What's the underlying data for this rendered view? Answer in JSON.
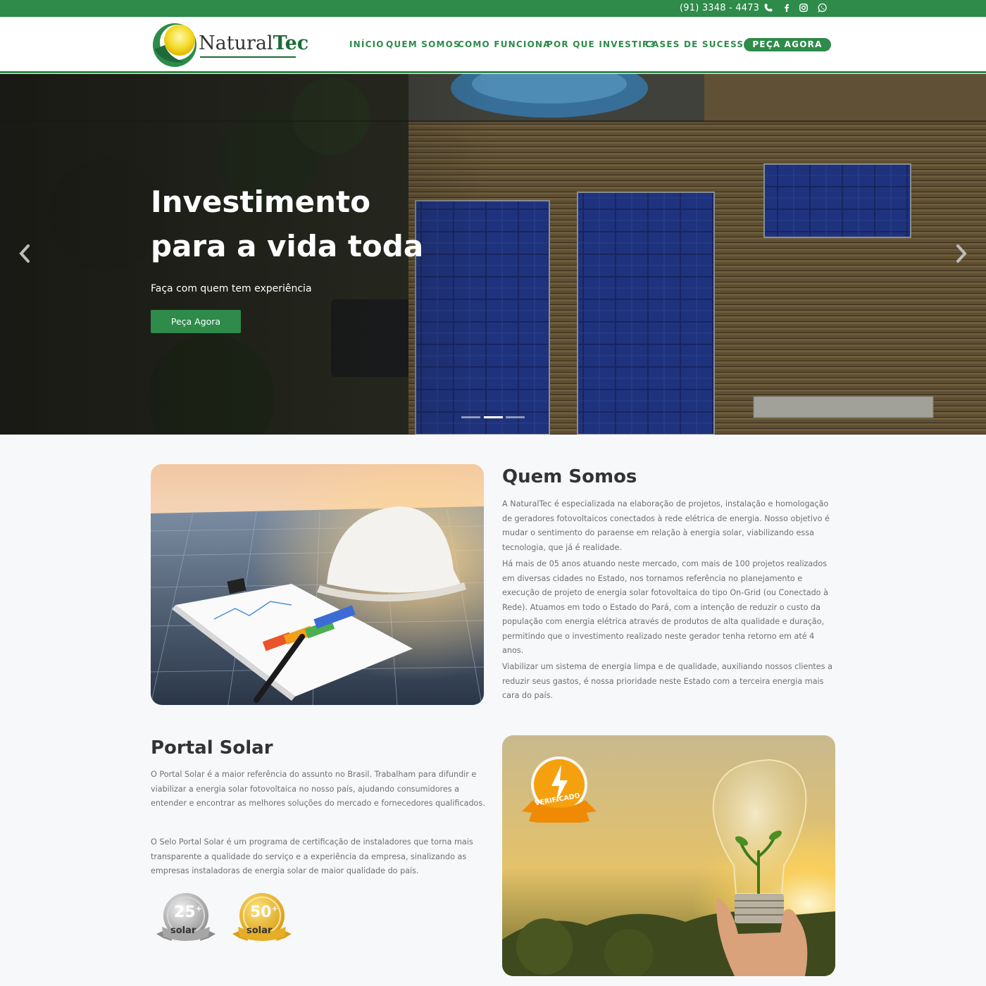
{
  "topbar": {
    "phone": "(91) 3348 - 4473",
    "icons": [
      "phone-icon",
      "facebook-icon",
      "instagram-icon",
      "whatsapp-icon"
    ],
    "color": "#2e8b4a"
  },
  "header": {
    "logo": {
      "part1": "Natural",
      "part2": "Tec"
    },
    "nav": [
      "INÍCIO",
      "QUEM SOMOS",
      "COMO FUNCIONA",
      "POR QUE INVESTIR?",
      "CASES DE SUCESSO"
    ],
    "cta": "PEÇA AGORA"
  },
  "hero": {
    "title_line1": "Investimento",
    "title_line2": "para a vida toda",
    "subtitle": "Faça com quem tem experiência",
    "button": "Peça Agora",
    "slide_count": 3,
    "active_slide": 2
  },
  "about": {
    "title": "Quem Somos",
    "paragraphs": [
      "A NaturalTec é especializada na elaboração de projetos, instalação e homologação de geradores fotovoltaicos conectados à rede elétrica de energia. Nosso objetivo é mudar o sentimento do paraense em relação à energia solar, viabilizando essa tecnologia, que já é realidade.",
      "Há mais de 05 anos atuando neste mercado, com mais de 100 projetos realizados em diversas cidades no Estado, nos tornamos referência no planejamento e execução de projeto de energia solar fotovoltaica do tipo On-Grid (ou Conectado à Rede). Atuamos em todo o Estado do Pará, com a intenção de reduzir o custo da população com energia elétrica através de produtos de alta qualidade e duração, permitindo que o investimento realizado neste gerador tenha retorno em até 4 anos.",
      "Viabilizar um sistema de energia limpa e de qualidade, auxiliando nossos clientes a reduzir seus gastos, é nossa prioridade neste Estado com a terceira energia mais cara do país."
    ]
  },
  "portal": {
    "title": "Portal Solar",
    "paragraphs": [
      "O Portal Solar é a maior referência do assunto no Brasil. Trabalham para difundir e viabilizar a energia solar fotovoltaica no nosso país, ajudando consumidores a entender e encontrar as melhores soluções do mercado e fornecedores qualificados.",
      "O Selo Portal Solar é um programa de certificação de instaladores que torna mais transparente a qualidade do serviço e a experiência da empresa, sinalizando as empresas instaladoras de energia solar de maior qualidade do país."
    ],
    "badges": [
      {
        "number": "25",
        "sup": "+",
        "word": "solar"
      },
      {
        "number": "50",
        "sup": "+",
        "word": "solar"
      }
    ],
    "verified_badge": "VERIFICADO"
  }
}
